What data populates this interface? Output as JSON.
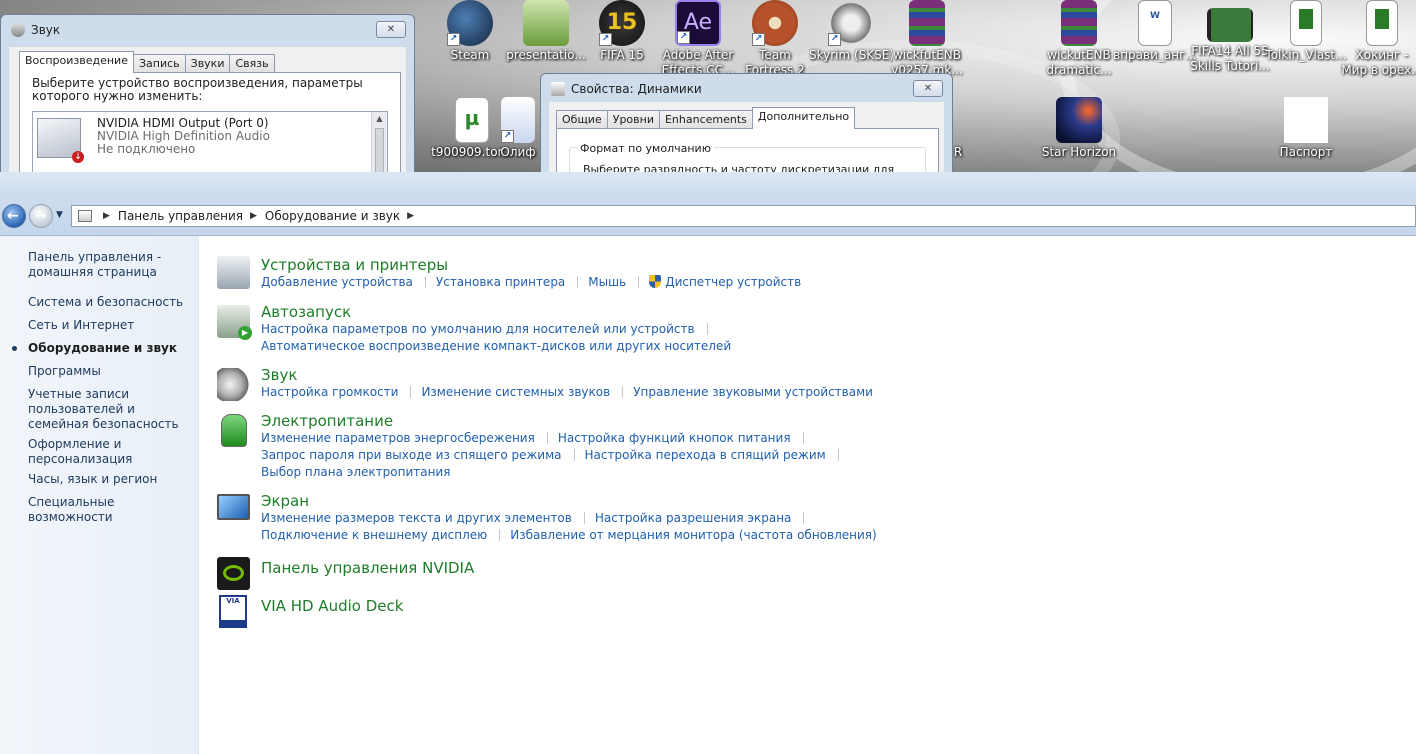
{
  "desktop": {
    "icons": [
      {
        "id": "steam",
        "label1": "Steam",
        "label2": "",
        "color": "#1b2838"
      },
      {
        "id": "presentation",
        "label1": "presentatio...",
        "label2": "",
        "color": "#6a9c3a"
      },
      {
        "id": "fifa15",
        "label1": "FIFA 15",
        "label2": "",
        "color": "#1a1a1a"
      },
      {
        "id": "ae",
        "label1": "Adobe After",
        "label2": "Effects CC...",
        "color": "#1a0b38"
      },
      {
        "id": "tf2",
        "label1": "Team",
        "label2": "Fortress 2",
        "color": "#b5512b"
      },
      {
        "id": "skyrim",
        "label1": "Skyrim (SKSE)",
        "label2": "",
        "color": "#2a2a2a"
      },
      {
        "id": "wickfut",
        "label1": "wickfutENB",
        "label2": "v0257.mk...",
        "color": "#7a2f7a"
      },
      {
        "id": "wickut",
        "label1": "wickutENB",
        "label2": "dramatic...",
        "color": "#7a2f7a"
      },
      {
        "id": "vpravi",
        "label1": "вправи_анг...",
        "label2": "",
        "color": "#ffffff"
      },
      {
        "id": "fifa14vid",
        "label1": "FIFA14 All 55",
        "label2": "Skills Tutori...",
        "color": "#2b5a2b"
      },
      {
        "id": "tolkin",
        "label1": "Tolkin_Vlast...",
        "label2": "",
        "color": "#ffffff"
      },
      {
        "id": "hoking",
        "label1": "Хокинг -",
        "label2": "Мир в орех...",
        "color": "#ffffff"
      },
      {
        "id": "torrent",
        "label1": "t900909.tor...",
        "label2": "",
        "color": "#ffffff"
      },
      {
        "id": "olif",
        "label1": "Олиф",
        "label2": "",
        "color": "#2255aa"
      },
      {
        "id": "r",
        "label1": "R",
        "label2": "",
        "color": "#333333"
      },
      {
        "id": "starhorizon",
        "label1": "Star Horizon",
        "label2": "",
        "color": "#10204a"
      },
      {
        "id": "pasport",
        "label1": "Паспорт",
        "label2": "",
        "color": "#ffffff"
      }
    ],
    "sound_dialog": {
      "title": "Звук",
      "close": "✕",
      "tabs": [
        "Воспроизведение",
        "Запись",
        "Звуки",
        "Связь"
      ],
      "instruction": "Выберите устройство воспроизведения, параметры которого нужно изменить:",
      "device": {
        "name": "NVIDIA HDMI Output (Port 0)",
        "driver": "NVIDIA High Definition Audio",
        "status": "Не подключено"
      }
    },
    "props_dialog": {
      "title": "Свойства: Динамики",
      "close": "✕",
      "tabs": [
        "Общие",
        "Уровни",
        "Enhancements",
        "Дополнительно"
      ],
      "group": "Формат по умолчанию",
      "hint": "Выберите разрядность и частоту дискретизации для"
    }
  },
  "explorer": {
    "breadcrumb": [
      "Панель управления",
      "Оборудование и звук"
    ],
    "sidebar": [
      {
        "label": "Панель управления - домашняя страница",
        "active": false
      },
      {
        "label": "Система и безопасность",
        "active": false
      },
      {
        "label": "Сеть и Интернет",
        "active": false
      },
      {
        "label": "Оборудование и звук",
        "active": true
      },
      {
        "label": "Программы",
        "active": false
      },
      {
        "label": "Учетные записи пользователей и семейная безопасность",
        "active": false
      },
      {
        "label": "Оформление и персонализация",
        "active": false
      },
      {
        "label": "Часы, язык и регион",
        "active": false
      },
      {
        "label": "Специальные возможности",
        "active": false
      }
    ],
    "categories": [
      {
        "title": "Устройства и принтеры",
        "icon": "printer-icon",
        "rows": [
          [
            "Добавление устройства",
            "Установка принтера",
            "Мышь",
            "Диспетчер устройств"
          ]
        ]
      },
      {
        "title": "Автозапуск",
        "icon": "autoplay-icon",
        "rows": [
          [
            "Настройка параметров по умолчанию для носителей или устройств"
          ],
          [
            "Автоматическое воспроизведение компакт-дисков или других носителей"
          ]
        ]
      },
      {
        "title": "Звук",
        "icon": "speaker-icon",
        "rows": [
          [
            "Настройка громкости",
            "Изменение системных звуков",
            "Управление звуковыми устройствами"
          ]
        ]
      },
      {
        "title": "Электропитание",
        "icon": "battery-icon",
        "rows": [
          [
            "Изменение параметров энергосбережения",
            "Настройка функций кнопок питания"
          ],
          [
            "Запрос пароля при выходе из спящего режима",
            "Настройка перехода в спящий режим"
          ],
          [
            "Выбор плана электропитания"
          ]
        ]
      },
      {
        "title": "Экран",
        "icon": "monitor-icon",
        "rows": [
          [
            "Изменение размеров текста и других элементов",
            "Настройка разрешения экрана"
          ],
          [
            "Подключение к внешнему дисплею",
            "Избавление от мерцания монитора (частота обновления)"
          ]
        ]
      },
      {
        "title": "Панель управления NVIDIA",
        "icon": "nvidia-icon",
        "rows": []
      },
      {
        "title": "VIA HD Audio Deck",
        "icon": "via-icon",
        "rows": []
      }
    ]
  }
}
